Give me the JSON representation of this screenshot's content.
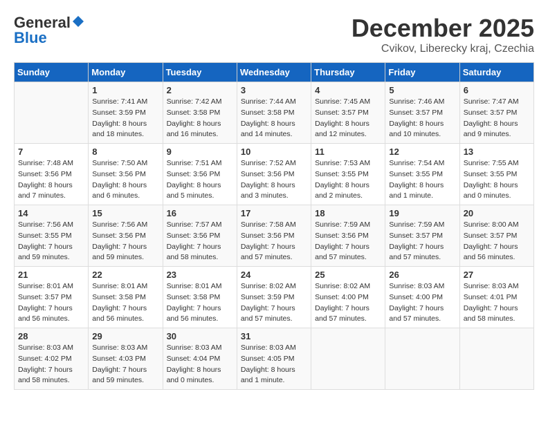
{
  "logo": {
    "line1": "General",
    "line2": "Blue"
  },
  "title": "December 2025",
  "subtitle": "Cvikov, Liberecky kraj, Czechia",
  "days_header": [
    "Sunday",
    "Monday",
    "Tuesday",
    "Wednesday",
    "Thursday",
    "Friday",
    "Saturday"
  ],
  "weeks": [
    [
      {
        "day": "",
        "info": ""
      },
      {
        "day": "1",
        "info": "Sunrise: 7:41 AM\nSunset: 3:59 PM\nDaylight: 8 hours\nand 18 minutes."
      },
      {
        "day": "2",
        "info": "Sunrise: 7:42 AM\nSunset: 3:58 PM\nDaylight: 8 hours\nand 16 minutes."
      },
      {
        "day": "3",
        "info": "Sunrise: 7:44 AM\nSunset: 3:58 PM\nDaylight: 8 hours\nand 14 minutes."
      },
      {
        "day": "4",
        "info": "Sunrise: 7:45 AM\nSunset: 3:57 PM\nDaylight: 8 hours\nand 12 minutes."
      },
      {
        "day": "5",
        "info": "Sunrise: 7:46 AM\nSunset: 3:57 PM\nDaylight: 8 hours\nand 10 minutes."
      },
      {
        "day": "6",
        "info": "Sunrise: 7:47 AM\nSunset: 3:57 PM\nDaylight: 8 hours\nand 9 minutes."
      }
    ],
    [
      {
        "day": "7",
        "info": "Sunrise: 7:48 AM\nSunset: 3:56 PM\nDaylight: 8 hours\nand 7 minutes."
      },
      {
        "day": "8",
        "info": "Sunrise: 7:50 AM\nSunset: 3:56 PM\nDaylight: 8 hours\nand 6 minutes."
      },
      {
        "day": "9",
        "info": "Sunrise: 7:51 AM\nSunset: 3:56 PM\nDaylight: 8 hours\nand 5 minutes."
      },
      {
        "day": "10",
        "info": "Sunrise: 7:52 AM\nSunset: 3:56 PM\nDaylight: 8 hours\nand 3 minutes."
      },
      {
        "day": "11",
        "info": "Sunrise: 7:53 AM\nSunset: 3:55 PM\nDaylight: 8 hours\nand 2 minutes."
      },
      {
        "day": "12",
        "info": "Sunrise: 7:54 AM\nSunset: 3:55 PM\nDaylight: 8 hours\nand 1 minute."
      },
      {
        "day": "13",
        "info": "Sunrise: 7:55 AM\nSunset: 3:55 PM\nDaylight: 8 hours\nand 0 minutes."
      }
    ],
    [
      {
        "day": "14",
        "info": "Sunrise: 7:56 AM\nSunset: 3:55 PM\nDaylight: 7 hours\nand 59 minutes."
      },
      {
        "day": "15",
        "info": "Sunrise: 7:56 AM\nSunset: 3:56 PM\nDaylight: 7 hours\nand 59 minutes."
      },
      {
        "day": "16",
        "info": "Sunrise: 7:57 AM\nSunset: 3:56 PM\nDaylight: 7 hours\nand 58 minutes."
      },
      {
        "day": "17",
        "info": "Sunrise: 7:58 AM\nSunset: 3:56 PM\nDaylight: 7 hours\nand 57 minutes."
      },
      {
        "day": "18",
        "info": "Sunrise: 7:59 AM\nSunset: 3:56 PM\nDaylight: 7 hours\nand 57 minutes."
      },
      {
        "day": "19",
        "info": "Sunrise: 7:59 AM\nSunset: 3:57 PM\nDaylight: 7 hours\nand 57 minutes."
      },
      {
        "day": "20",
        "info": "Sunrise: 8:00 AM\nSunset: 3:57 PM\nDaylight: 7 hours\nand 56 minutes."
      }
    ],
    [
      {
        "day": "21",
        "info": "Sunrise: 8:01 AM\nSunset: 3:57 PM\nDaylight: 7 hours\nand 56 minutes."
      },
      {
        "day": "22",
        "info": "Sunrise: 8:01 AM\nSunset: 3:58 PM\nDaylight: 7 hours\nand 56 minutes."
      },
      {
        "day": "23",
        "info": "Sunrise: 8:01 AM\nSunset: 3:58 PM\nDaylight: 7 hours\nand 56 minutes."
      },
      {
        "day": "24",
        "info": "Sunrise: 8:02 AM\nSunset: 3:59 PM\nDaylight: 7 hours\nand 57 minutes."
      },
      {
        "day": "25",
        "info": "Sunrise: 8:02 AM\nSunset: 4:00 PM\nDaylight: 7 hours\nand 57 minutes."
      },
      {
        "day": "26",
        "info": "Sunrise: 8:03 AM\nSunset: 4:00 PM\nDaylight: 7 hours\nand 57 minutes."
      },
      {
        "day": "27",
        "info": "Sunrise: 8:03 AM\nSunset: 4:01 PM\nDaylight: 7 hours\nand 58 minutes."
      }
    ],
    [
      {
        "day": "28",
        "info": "Sunrise: 8:03 AM\nSunset: 4:02 PM\nDaylight: 7 hours\nand 58 minutes."
      },
      {
        "day": "29",
        "info": "Sunrise: 8:03 AM\nSunset: 4:03 PM\nDaylight: 7 hours\nand 59 minutes."
      },
      {
        "day": "30",
        "info": "Sunrise: 8:03 AM\nSunset: 4:04 PM\nDaylight: 8 hours\nand 0 minutes."
      },
      {
        "day": "31",
        "info": "Sunrise: 8:03 AM\nSunset: 4:05 PM\nDaylight: 8 hours\nand 1 minute."
      },
      {
        "day": "",
        "info": ""
      },
      {
        "day": "",
        "info": ""
      },
      {
        "day": "",
        "info": ""
      }
    ]
  ]
}
